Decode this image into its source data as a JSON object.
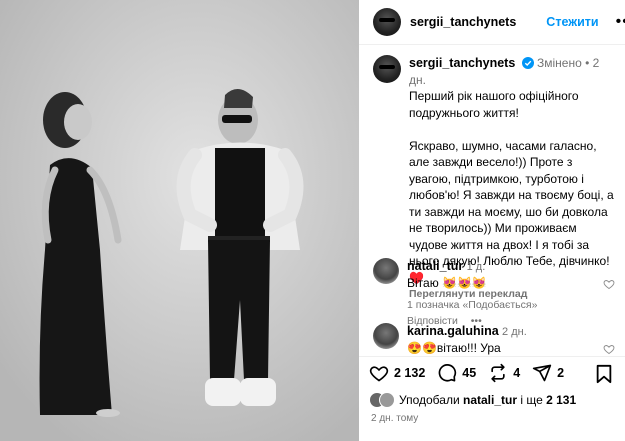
{
  "post": {
    "author": "sergii_tanchynets",
    "follow_label": "Стежити",
    "more_label": "•••",
    "edited_label": "Змінено",
    "caption_time": "2 дн.",
    "caption_text": "Перший рік нашого офіційного подружнього життя!\n\nЯскраво, шумно, часами галасно, але завжди весело!)) Проте з увагою, підтримкою, турботою і любов'ю! Я завжди на твоєму боці, а ти завжди на моєму, шо би довкола не творилось)) Ми проживаєм чудове життя на двох! І я тобі за нього дякую! Люблю Тебе, дівчинко! ♥️",
    "translate_label": "Переглянути переклад"
  },
  "comments": [
    {
      "user": "natali_tur",
      "time": "1 д.",
      "text": "Вітаю 😻😻😻",
      "likes": "1 позначка «Подобається»",
      "reply": "Відповісти",
      "more": "•••"
    },
    {
      "user": "karina.galuhina",
      "time": "2 дн.",
      "text": "😍😍вітаю!!! Ура"
    }
  ],
  "actions": {
    "like_count": "2 132",
    "comment_count": "45",
    "repost_count": "4",
    "share_count": "2",
    "liked_by_prefix": "Уподобали",
    "liked_by_user": "natali_tur",
    "liked_by_suffix": "і ще",
    "liked_by_more": "2 131",
    "posted_ago": "2 дн. тому"
  },
  "icons": [
    "verified-badge-icon",
    "heart-icon",
    "comment-icon",
    "repost-icon",
    "share-icon",
    "bookmark-icon",
    "more-icon"
  ],
  "colors": {
    "accent": "#0095f6",
    "muted": "#737373",
    "verified": "#0095f6",
    "heart_red": "#ed4956"
  }
}
